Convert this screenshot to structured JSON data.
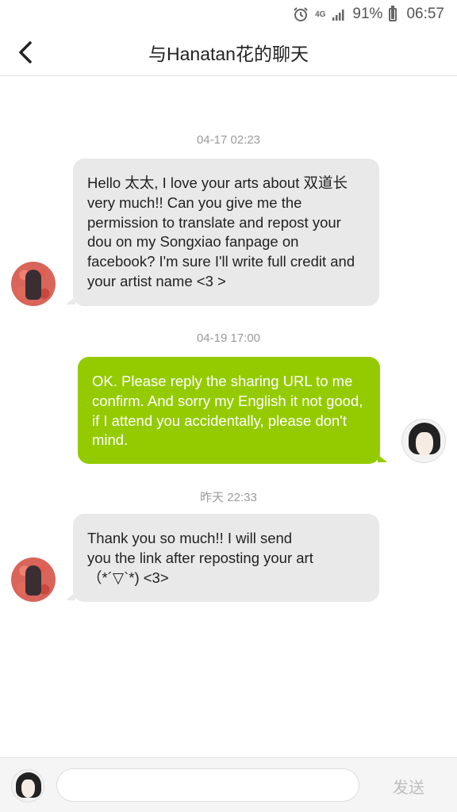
{
  "status_bar": {
    "network": "4G",
    "battery": "91%",
    "battery_level": 0.91,
    "time": "06:57",
    "icons": [
      "alarm-icon",
      "network-4g-icon",
      "signal-icon",
      "battery-icon"
    ]
  },
  "header": {
    "title": "与Hanatan花的聊天",
    "back_icon": "chevron-left-icon"
  },
  "messages": [
    {
      "timestamp": "04-17 02:23",
      "direction": "incoming",
      "text": "Hello 太太, I love your arts about 双道长 very much!! Can you give me the permission to translate and repost your dou on my Songxiao fanpage on facebook? I'm sure I'll write full credit and your artist name <3 >"
    },
    {
      "timestamp": "04-19 17:00",
      "direction": "outgoing",
      "text": "OK. Please reply the sharing URL to me confirm. And sorry my English it not good, if I attend you accidentally, please don't mind."
    },
    {
      "timestamp": "昨天 22:33",
      "direction": "incoming",
      "text": "Thank you so much!! I will send you the link after reposting your art（*´▽`*) <3>"
    }
  ],
  "input_bar": {
    "placeholder": "",
    "send_label": "发送"
  },
  "colors": {
    "outgoing_bubble": "#94cb00",
    "incoming_bubble": "#e9e9e9",
    "send_disabled": "#bdbdbd"
  }
}
